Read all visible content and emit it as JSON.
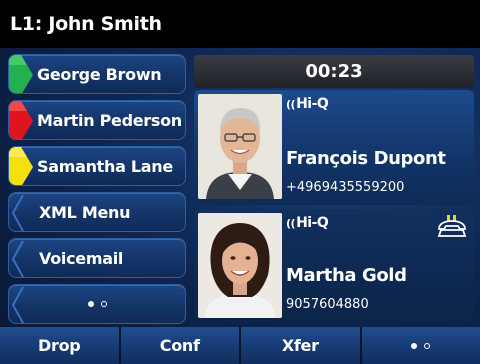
{
  "header": {
    "title": "L1: John Smith"
  },
  "line_keys": [
    {
      "label": "George Brown",
      "indicator_color": "#22b14c"
    },
    {
      "label": "Martin Pederson",
      "indicator_color": "#e0141c"
    },
    {
      "label": "Samantha Lane",
      "indicator_color": "#f5e00f"
    },
    {
      "label": "XML Menu"
    },
    {
      "label": "Voicemail"
    },
    {
      "label": "more-dots-icon"
    }
  ],
  "timer": {
    "value": "00:23"
  },
  "calls": [
    {
      "codec_badge": "Hi-Q",
      "name": "François Dupont",
      "number": "+4969435559200",
      "photo": "man-portrait",
      "on_hold": false
    },
    {
      "codec_badge": "Hi-Q",
      "name": "Martha Gold",
      "number": "9057604880",
      "photo": "woman-portrait",
      "on_hold": true,
      "hold_icon": "hold-phone-icon"
    }
  ],
  "soft_keys": [
    {
      "label": "Drop"
    },
    {
      "label": "Conf"
    },
    {
      "label": "Xfer"
    },
    {
      "label": "more-dots-icon"
    }
  ],
  "colors": {
    "title_bar": "#000000",
    "key_blue": "#163a73",
    "hold_icon": "#f2d600"
  }
}
